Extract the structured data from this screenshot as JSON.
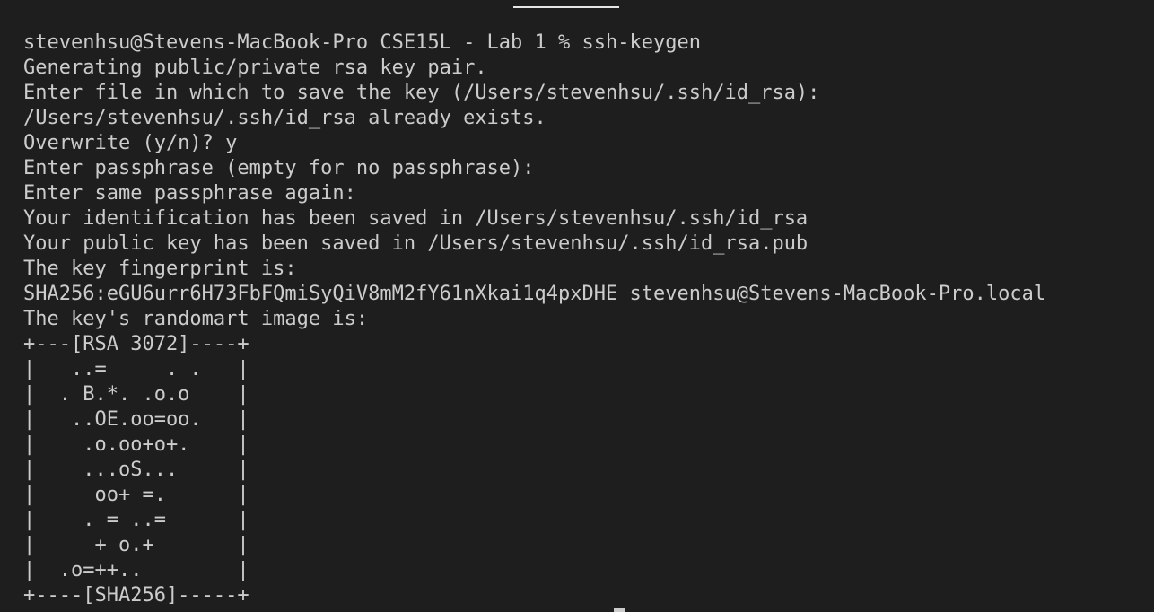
{
  "terminal": {
    "lines": [
      "stevenhsu@Stevens-MacBook-Pro CSE15L - Lab 1 % ssh-keygen",
      "Generating public/private rsa key pair.",
      "Enter file in which to save the key (/Users/stevenhsu/.ssh/id_rsa):",
      "/Users/stevenhsu/.ssh/id_rsa already exists.",
      "Overwrite (y/n)? y",
      "Enter passphrase (empty for no passphrase):",
      "Enter same passphrase again:",
      "Your identification has been saved in /Users/stevenhsu/.ssh/id_rsa",
      "Your public key has been saved in /Users/stevenhsu/.ssh/id_rsa.pub",
      "The key fingerprint is:",
      "SHA256:eGU6urr6H73FbFQmiSyQiV8mM2fY61nXkai1q4pxDHE stevenhsu@Stevens-MacBook-Pro.local",
      "The key's randomart image is:",
      "+---[RSA 3072]----+",
      "|   ..=     . .   |",
      "|  . B.*. .o.o    |",
      "|   ..OE.oo=oo.   |",
      "|    .o.oo+o+.    |",
      "|    ...oS...     |",
      "|     oo+ =.      |",
      "|    . = ..=      |",
      "|     + o.+       |",
      "|  .o=++..        |",
      "+----[SHA256]-----+"
    ]
  },
  "colors": {
    "background": "#1e1e1e",
    "text": "#cccccc",
    "cursor": "#cccccc",
    "tab_indicator": "#e6e6e6"
  }
}
